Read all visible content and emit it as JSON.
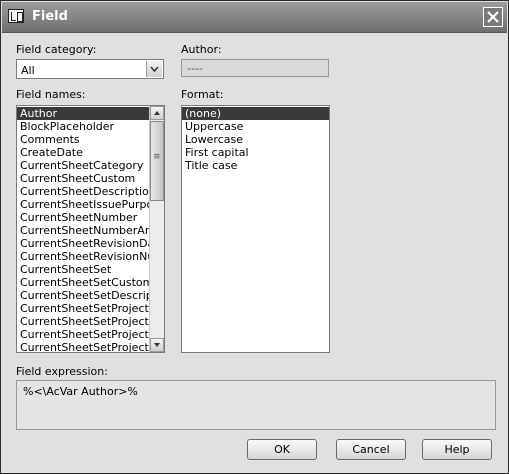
{
  "window": {
    "title": "Field"
  },
  "field_category": {
    "label": "Field category:",
    "value": "All"
  },
  "author": {
    "label": "Author:",
    "value": "----"
  },
  "field_names": {
    "label": "Field names:",
    "items": [
      "Author",
      "BlockPlaceholder",
      "Comments",
      "CreateDate",
      "CurrentSheetCategory",
      "CurrentSheetCustom",
      "CurrentSheetDescription",
      "CurrentSheetIssuePurpose",
      "CurrentSheetNumber",
      "CurrentSheetNumberAndT",
      "CurrentSheetRevisionDate",
      "CurrentSheetRevisionNuml",
      "CurrentSheetSet",
      "CurrentSheetSetCustom",
      "CurrentSheetSetDescriptio",
      "CurrentSheetSetProjectMil",
      "CurrentSheetSetProjectNa",
      "CurrentSheetSetProjectNu",
      "CurrentSheetSetProjectPh"
    ],
    "selected": "Author"
  },
  "format": {
    "label": "Format:",
    "items": [
      "(none)",
      "Uppercase",
      "Lowercase",
      "First capital",
      "Title case"
    ],
    "selected": "(none)"
  },
  "field_expression": {
    "label": "Field expression:",
    "value": "%<\\AcVar Author>%"
  },
  "buttons": {
    "ok": "OK",
    "cancel": "Cancel",
    "help": "Help"
  }
}
